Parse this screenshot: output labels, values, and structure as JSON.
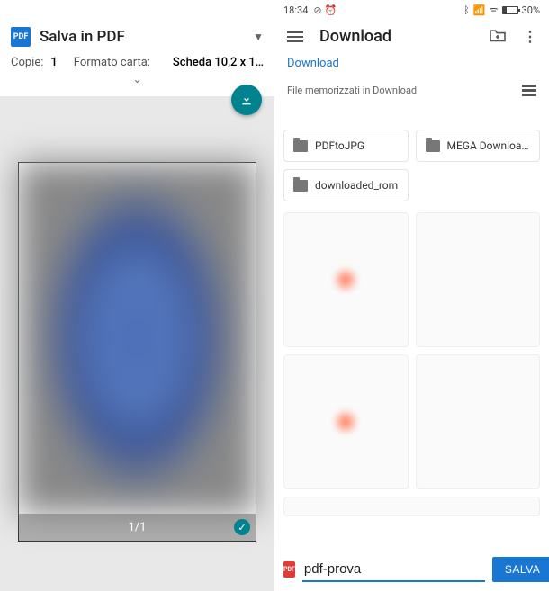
{
  "left": {
    "title": "Salva in PDF",
    "copies_label": "Copie:",
    "copies_value": "1",
    "format_label": "Formato carta:",
    "format_value": "Scheda 10,2 x 1…",
    "page_indicator": "1/1"
  },
  "right": {
    "status": {
      "time": "18:34",
      "battery": "30%"
    },
    "title": "Download",
    "breadcrumb": "Download",
    "section_label": "File memorizzati in Download",
    "folders": [
      {
        "name": "PDFtoJPG"
      },
      {
        "name": "MEGA Downloa…"
      },
      {
        "name": "downloaded_rom"
      }
    ],
    "filename": "pdf-prova",
    "save_label": "SALVA"
  }
}
